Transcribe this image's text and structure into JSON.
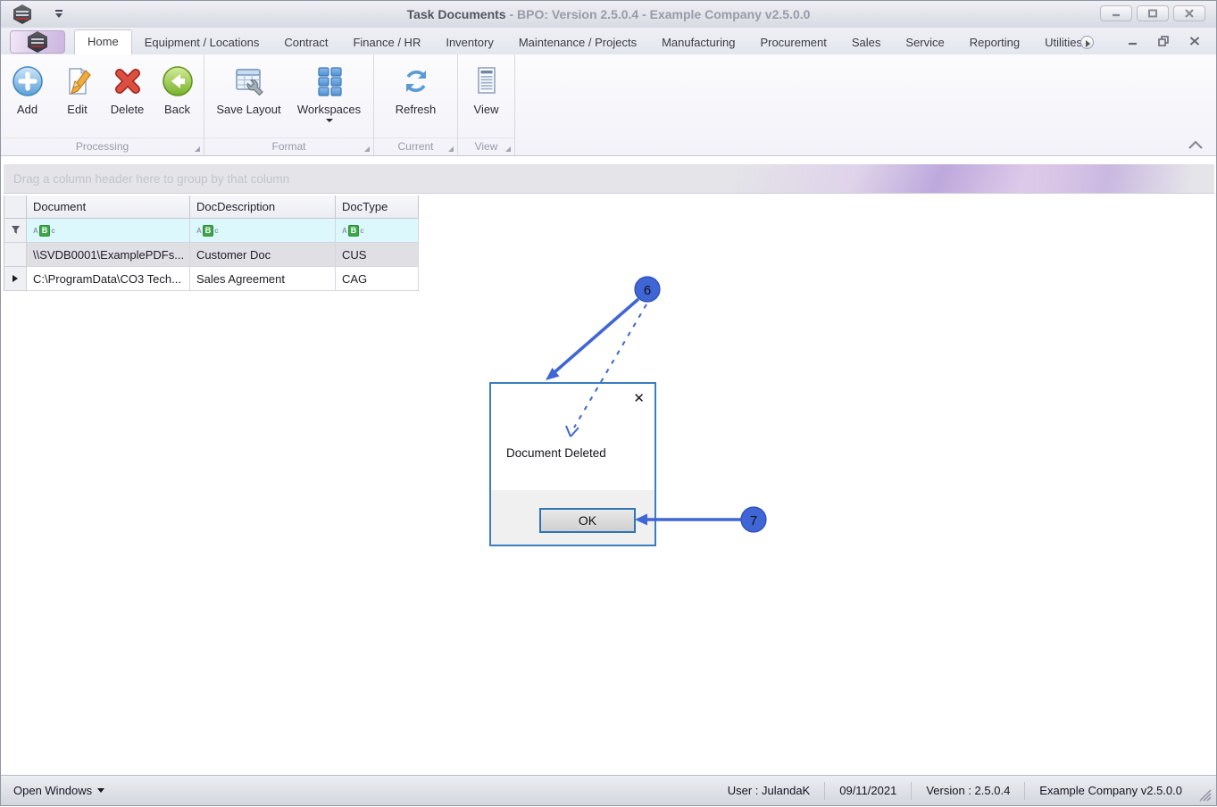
{
  "window": {
    "title_primary": "Task Documents",
    "title_secondary": "- BPO: Version 2.5.0.4 - Example Company v2.5.0.0"
  },
  "ribbon": {
    "tabs": [
      {
        "label": "Home",
        "active": true
      },
      {
        "label": "Equipment / Locations",
        "active": false
      },
      {
        "label": "Contract",
        "active": false
      },
      {
        "label": "Finance / HR",
        "active": false
      },
      {
        "label": "Inventory",
        "active": false
      },
      {
        "label": "Maintenance / Projects",
        "active": false
      },
      {
        "label": "Manufacturing",
        "active": false
      },
      {
        "label": "Procurement",
        "active": false
      },
      {
        "label": "Sales",
        "active": false
      },
      {
        "label": "Service",
        "active": false
      },
      {
        "label": "Reporting",
        "active": false
      },
      {
        "label": "Utilities",
        "active": false
      }
    ],
    "groups": [
      {
        "label": "Processing",
        "buttons": [
          {
            "label": "Add"
          },
          {
            "label": "Edit"
          },
          {
            "label": "Delete"
          },
          {
            "label": "Back"
          }
        ]
      },
      {
        "label": "Format",
        "buttons": [
          {
            "label": "Save Layout"
          },
          {
            "label": "Workspaces",
            "has_dropdown": true
          }
        ]
      },
      {
        "label": "Current",
        "buttons": [
          {
            "label": "Refresh"
          }
        ]
      },
      {
        "label": "View",
        "buttons": [
          {
            "label": "View"
          }
        ]
      }
    ]
  },
  "grid": {
    "group_by_hint": "Drag a column header here to group by that column",
    "columns": [
      "Document",
      "DocDescription",
      "DocType"
    ],
    "filter_icon": {
      "a": "A",
      "b": "B",
      "c": "c"
    },
    "rows": [
      {
        "cells": [
          "\\\\SVDB0001\\ExamplePDFs...",
          "Customer Doc",
          "CUS"
        ],
        "selected": true
      },
      {
        "cells": [
          "C:\\ProgramData\\CO3 Tech...",
          "Sales Agreement",
          "CAG"
        ],
        "selected": false
      }
    ]
  },
  "dialog": {
    "message": "Document Deleted",
    "ok_label": "OK",
    "close_glyph": "✕"
  },
  "annotations": [
    {
      "label": "6"
    },
    {
      "label": "7"
    }
  ],
  "status_bar": {
    "open_windows": "Open Windows",
    "user": "User : JulandaK",
    "date": "09/11/2021",
    "version": "Version : 2.5.0.4",
    "company": "Example Company v2.5.0.0"
  },
  "colors": {
    "annotation_blue": "#3f66d4",
    "dialog_border": "#2e75b6",
    "filter_green": "#3da84a"
  }
}
